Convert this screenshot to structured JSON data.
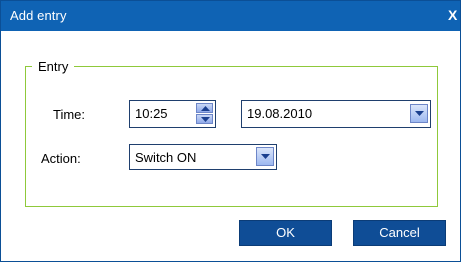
{
  "window": {
    "title": "Add entry",
    "close_glyph": "X"
  },
  "group": {
    "legend": "Entry"
  },
  "fields": {
    "time_label": "Time:",
    "time_value": "10:25",
    "date_value": "19.08.2010",
    "action_label": "Action:",
    "action_value": "Switch ON"
  },
  "buttons": {
    "ok": "OK",
    "cancel": "Cancel"
  },
  "icons": {
    "spinner": "up-down-arrows-icon",
    "dropdown": "chevron-down-icon"
  },
  "colors": {
    "titlebar": "#0f63b4",
    "group_border": "#8fc93a",
    "button_bg": "#0f4d96"
  }
}
